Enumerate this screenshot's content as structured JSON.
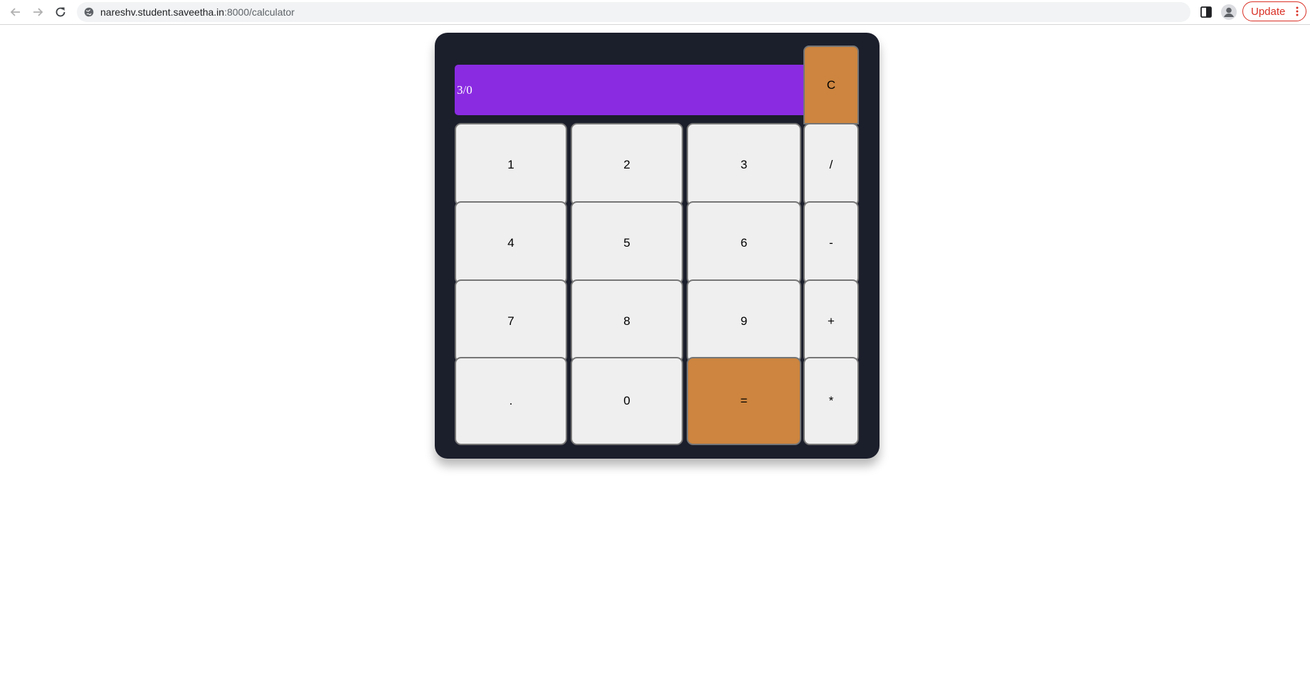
{
  "browser": {
    "url_host": "nareshv.student.saveetha.in",
    "url_rest": ":8000/calculator",
    "update_label": "Update",
    "icons": {
      "back": "arrow-left-icon",
      "forward": "arrow-right-icon",
      "reload": "reload-icon",
      "site_info": "site-info-icon",
      "side_panel": "side-panel-icon",
      "profile": "profile-icon",
      "menu": "kebab-menu-icon"
    }
  },
  "calculator": {
    "display": "3/0",
    "clear_label": "C",
    "keys": {
      "k1": "1",
      "k2": "2",
      "k3": "3",
      "divide": "/",
      "k4": "4",
      "k5": "5",
      "k6": "6",
      "minus": "-",
      "k7": "7",
      "k8": "8",
      "k9": "9",
      "plus": "+",
      "dot": ".",
      "k0": "0",
      "equals": "=",
      "multiply": "*"
    },
    "colors": {
      "body": "#1b1e2b",
      "display": "#8a2be2",
      "key": "#efefef",
      "accent": "#cd853f"
    }
  }
}
